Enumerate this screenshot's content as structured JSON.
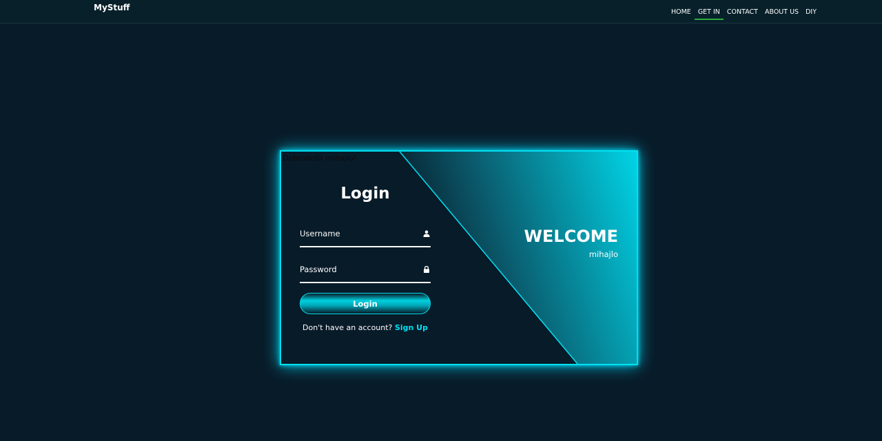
{
  "navbar": {
    "brand": "MyStuff",
    "links": [
      "HOME",
      "GET IN",
      "CONTACT",
      "ABOUT US",
      "DIY"
    ],
    "active_link": "GET IN",
    "active_underline_color": "#2eaa3e"
  },
  "card": {
    "greeting": "Dobrodošli mihajlo!",
    "form": {
      "title": "Login",
      "username_placeholder": "Username",
      "username_icon": "user-icon",
      "password_placeholder": "Password",
      "password_icon": "lock-icon",
      "submit_label": "Login",
      "signup_prompt": "Don't have an account?",
      "signup_link": "Sign Up"
    },
    "welcome": {
      "title": "WELCOME",
      "name": "mihajlo"
    },
    "accent_color": "#00e0f2",
    "background_color": "#081b29"
  }
}
